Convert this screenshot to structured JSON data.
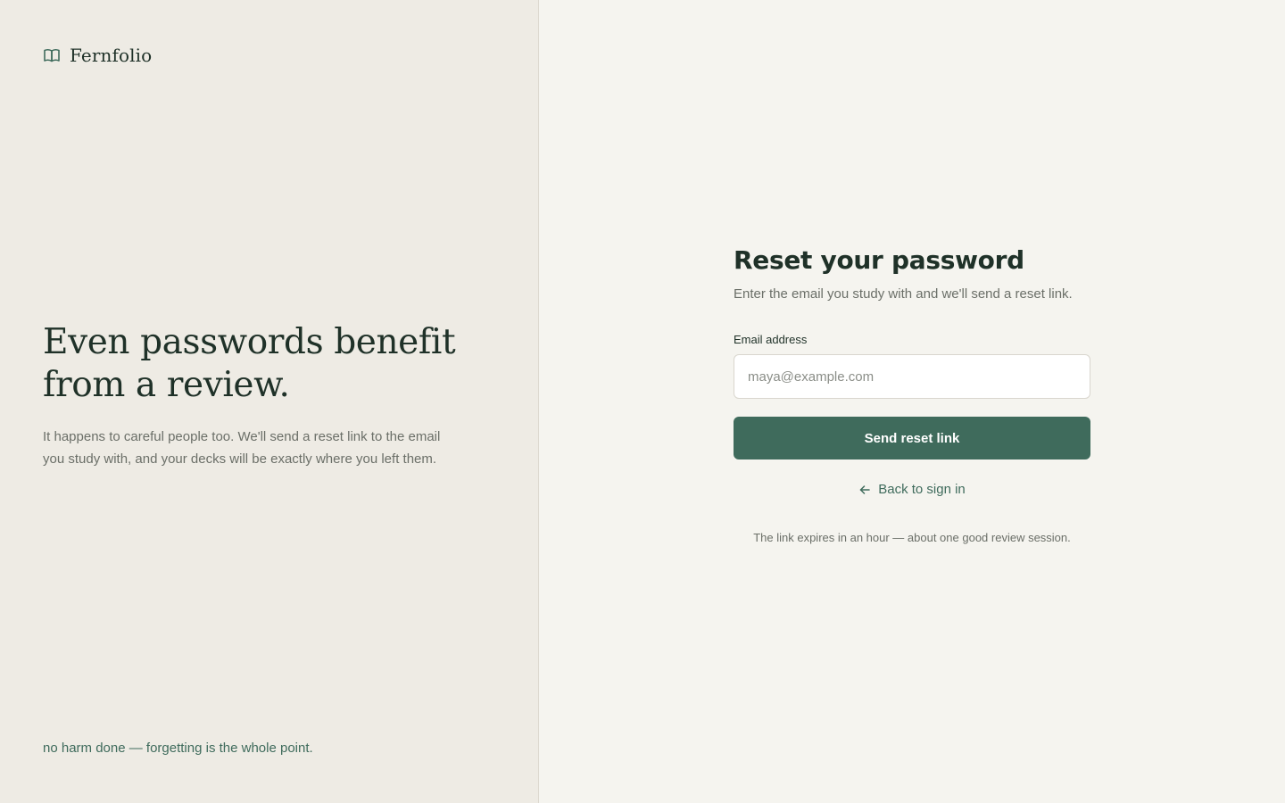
{
  "brand": {
    "name": "Fernfolio",
    "icon": "open-book-icon"
  },
  "hero": {
    "title": "Even passwords benefit from a review.",
    "body": "It happens to careful people too. We'll send a reset link to the email you study with, and your decks will be exactly where you left them."
  },
  "left_footer": "no harm done — forgetting is the whole point.",
  "form": {
    "title": "Reset your password",
    "subtitle": "Enter the email you study with and we'll send a reset link.",
    "email_label": "Email address",
    "email_placeholder": "maya@example.com",
    "email_value": "",
    "submit_label": "Send reset link",
    "back_label": "Back to sign in",
    "back_icon": "arrow-left-icon",
    "note": "The link expires in an hour — about one good review session."
  },
  "colors": {
    "accent": "#3f6b5c",
    "ink": "#1f3128",
    "left_bg": "#eeebe4",
    "right_bg": "#f5f4ef",
    "muted": "#6b6f68"
  }
}
